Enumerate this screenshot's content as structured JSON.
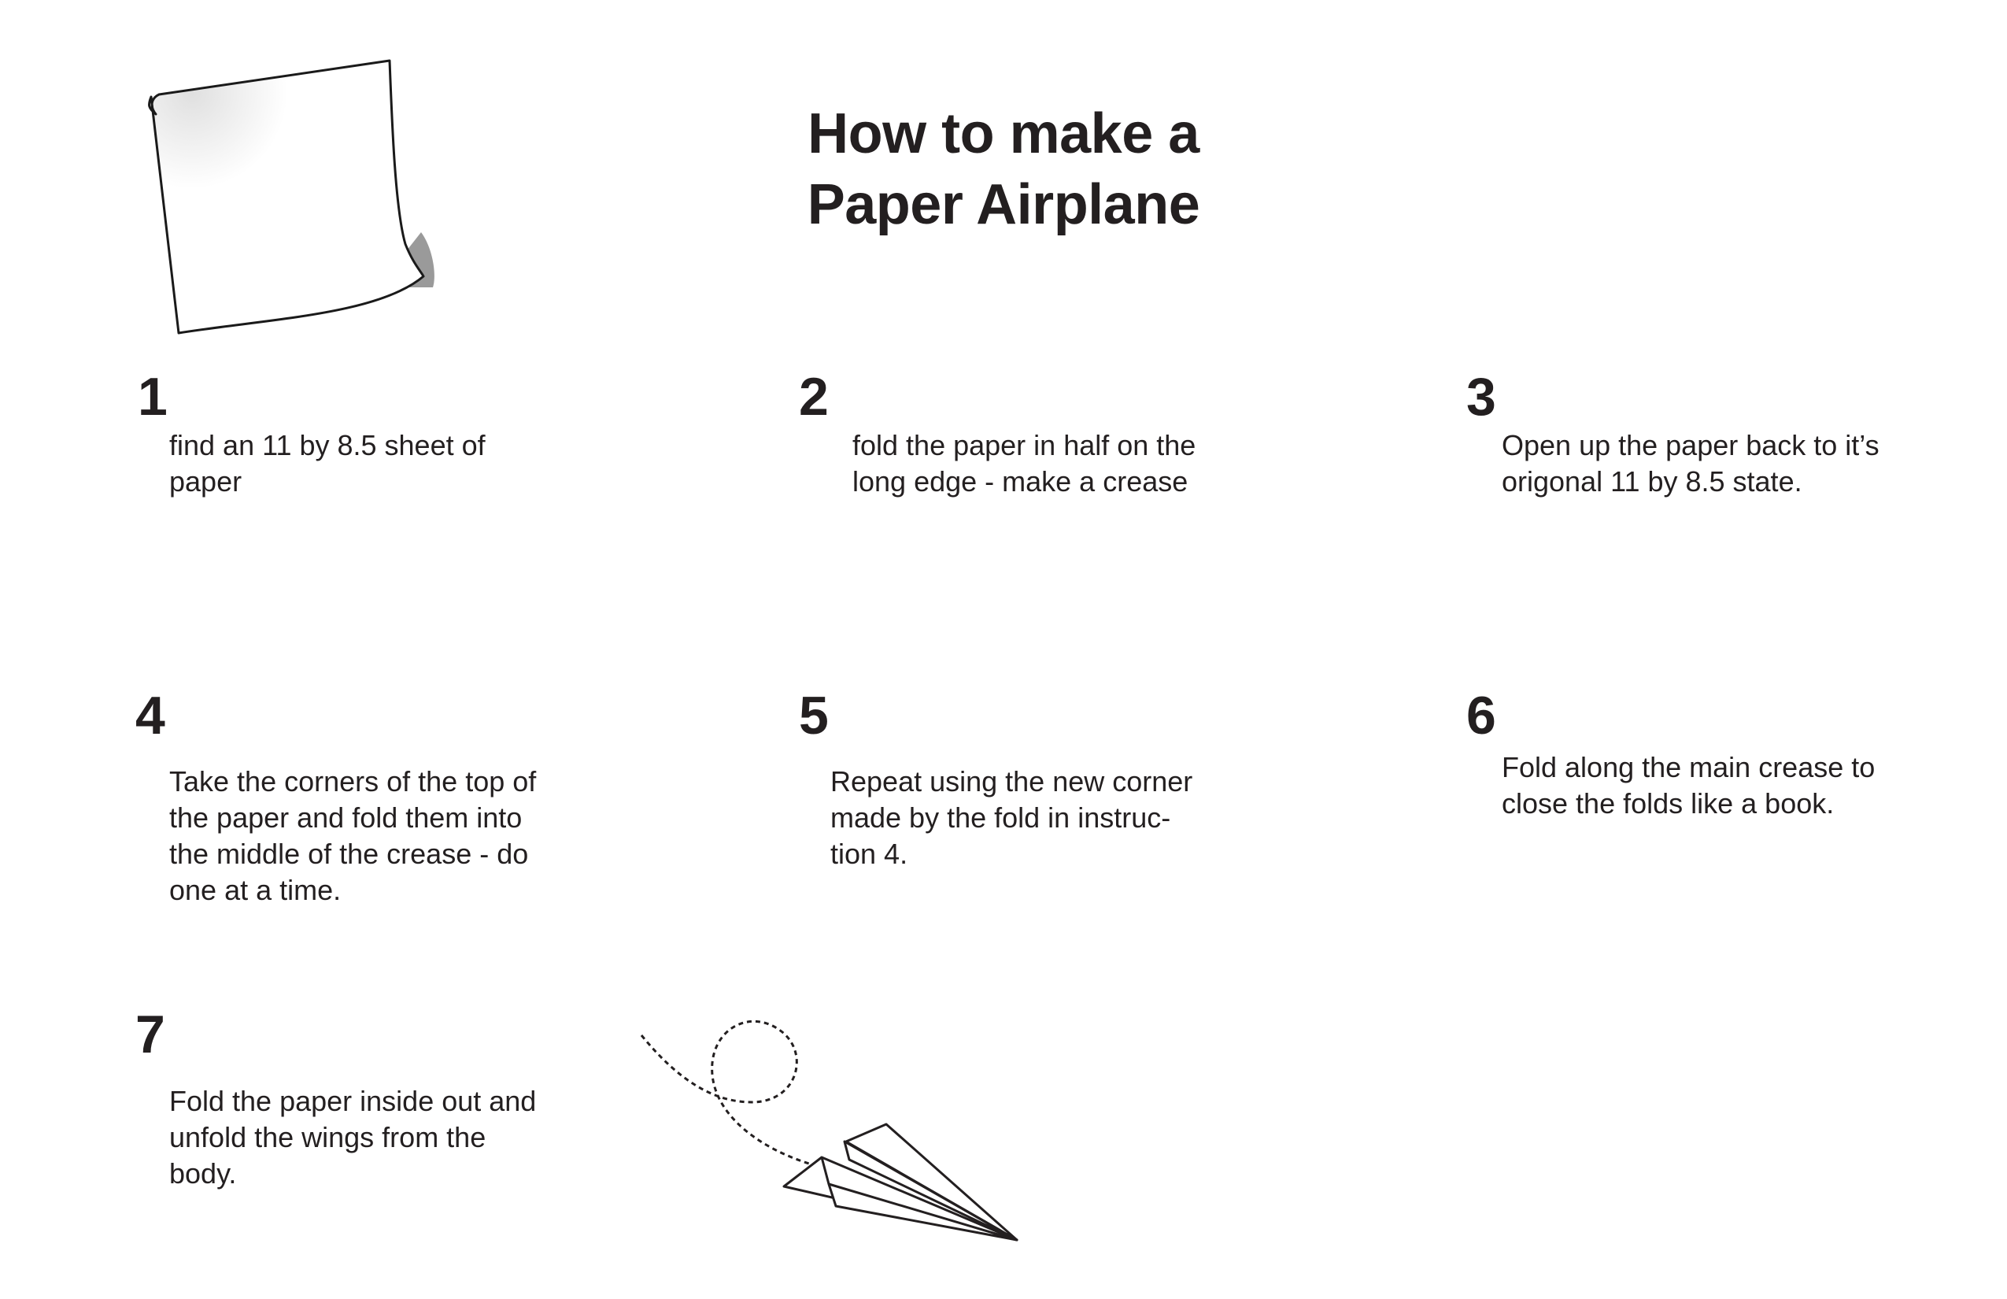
{
  "title": {
    "line1": "How to make a",
    "line2": "Paper Airplane"
  },
  "steps": [
    {
      "num": "1",
      "lines": [
        "find an 11 by 8.5 sheet of",
        "paper"
      ]
    },
    {
      "num": "2",
      "lines": [
        "fold the paper in half on the",
        "long edge - make a crease"
      ]
    },
    {
      "num": "3",
      "lines": [
        "Open up the paper back to it’s",
        "origonal 11 by 8.5 state."
      ]
    },
    {
      "num": "4",
      "lines": [
        "Take the corners of the top of",
        "the paper and fold them into",
        "the middle of the crease - do",
        "one at a time."
      ]
    },
    {
      "num": "5",
      "lines": [
        "Repeat using the new corner",
        "made by the fold in instruc-",
        "tion 4."
      ]
    },
    {
      "num": "6",
      "lines": [
        "Fold along the main crease to",
        "close the folds like a book."
      ]
    },
    {
      "num": "7",
      "lines": [
        "Fold the paper inside out and",
        "unfold the wings from the",
        "body."
      ]
    }
  ],
  "icons": {
    "paper": "sheet-of-paper-icon",
    "airplane": "paper-airplane-icon"
  }
}
